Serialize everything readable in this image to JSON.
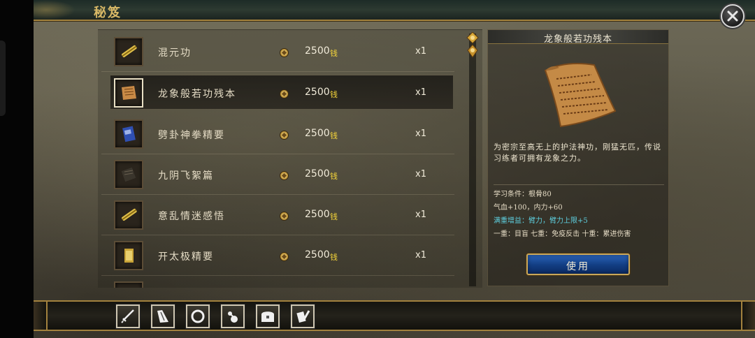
{
  "header": {
    "title": "秘笈"
  },
  "items": [
    {
      "name": "混元功",
      "icon": "gold-brush-icon",
      "price": "2500",
      "currency": "钱",
      "qty": "x1",
      "selected": false
    },
    {
      "name": "龙象般若功残本",
      "icon": "parchment-icon",
      "price": "2500",
      "currency": "钱",
      "qty": "x1",
      "selected": true
    },
    {
      "name": "劈卦神拳精要",
      "icon": "blue-book-icon",
      "price": "2500",
      "currency": "钱",
      "qty": "x1",
      "selected": false
    },
    {
      "name": "九阴飞絮篇",
      "icon": "dark-book-icon",
      "price": "2500",
      "currency": "钱",
      "qty": "x1",
      "selected": false
    },
    {
      "name": "意乱情迷感悟",
      "icon": "gold-brush-icon",
      "price": "2500",
      "currency": "钱",
      "qty": "x1",
      "selected": false
    },
    {
      "name": "开太极精要",
      "icon": "yellow-book-icon",
      "price": "2500",
      "currency": "钱",
      "qty": "x1",
      "selected": false
    }
  ],
  "detail": {
    "title": "龙象般若功残本",
    "description": "为密宗至高无上的护法神功，刚猛无匹，传说习练者可拥有龙象之力。",
    "requirement": "学习条件：根骨80",
    "bonus": "气血+100，内力+60",
    "full_bonus": "满重增益：臂力，臂力上限+5",
    "tiers": "一重：目盲 七重：免疫反击 十重：累进伤害",
    "use_label": "使用"
  },
  "tabs": [
    {
      "name": "weapon",
      "icon": "sword-icon"
    },
    {
      "name": "armor",
      "icon": "robe-icon"
    },
    {
      "name": "ring",
      "icon": "ring-icon"
    },
    {
      "name": "consumable",
      "icon": "gourd-icon"
    },
    {
      "name": "box",
      "icon": "chest-icon"
    },
    {
      "name": "manual",
      "icon": "scroll-brush-icon"
    }
  ],
  "colors": {
    "accent_gold": "#a3823e",
    "currency_yellow": "#f4d43a",
    "cyan_text": "#5ed0e0",
    "button_blue": "#123d82"
  }
}
